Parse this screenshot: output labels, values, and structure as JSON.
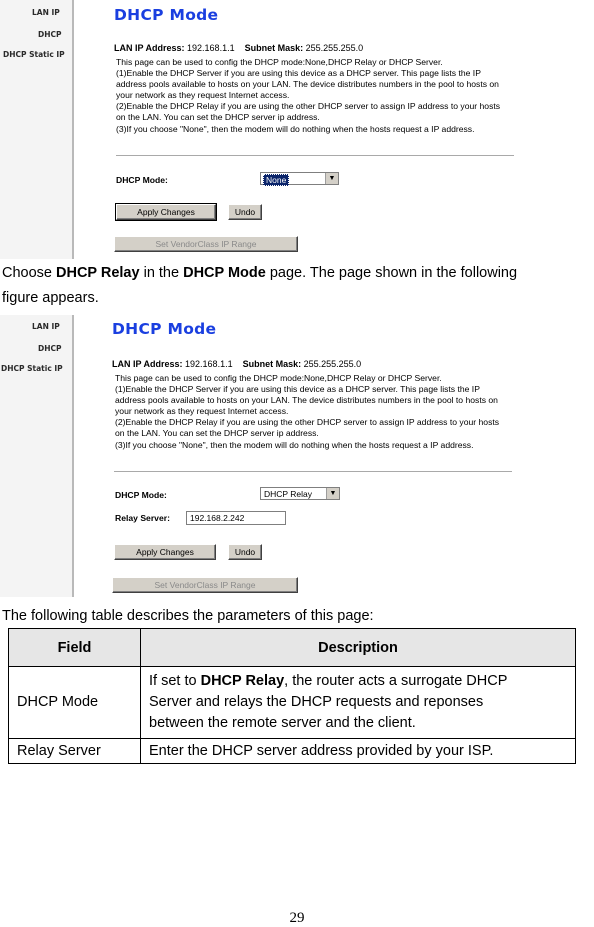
{
  "screenshot1": {
    "sidebar": [
      "LAN IP",
      "DHCP",
      "DHCP Static IP"
    ],
    "title": "DHCP Mode",
    "lan_ip_label": "LAN IP Address:",
    "lan_ip_value": "192.168.1.1",
    "subnet_label": "Subnet Mask:",
    "subnet_value": "255.255.255.0",
    "description": [
      "This page can be used to config the DHCP mode:None,DHCP Relay or DHCP Server.",
      "(1)Enable the DHCP Server if you are using this device as a DHCP server. This page lists the IP",
      "address pools available to hosts on your LAN. The device distributes numbers in the pool to hosts on",
      "your network as they request Internet access.",
      "(2)Enable the DHCP Relay if you are using the other DHCP server to assign IP address to your hosts",
      "on the LAN. You can set the DHCP server ip address.",
      "(3)If you choose \"None\", then the modem will do nothing when the hosts request a IP address."
    ],
    "dhcp_mode_label": "DHCP Mode:",
    "dhcp_mode_value": "None",
    "apply_label": "Apply Changes",
    "undo_label": "Undo",
    "vendor_label": "Set VendorClass IP Range"
  },
  "para1_parts": [
    "Choose ",
    "DHCP Relay",
    " in the ",
    "DHCP Mode",
    " page. The page shown in the following"
  ],
  "para1_line2": "figure appears.",
  "screenshot2": {
    "sidebar": [
      "LAN IP",
      "DHCP",
      "DHCP Static IP"
    ],
    "title": "DHCP Mode",
    "lan_ip_label": "LAN IP Address:",
    "lan_ip_value": "192.168.1.1",
    "subnet_label": "Subnet Mask:",
    "subnet_value": "255.255.255.0",
    "description": [
      "This page can be used to config the DHCP mode:None,DHCP Relay or DHCP Server.",
      "(1)Enable the DHCP Server if you are using this device as a DHCP server. This page lists the IP",
      "address pools available to hosts on your LAN. The device distributes numbers in the pool to hosts on",
      "your network as they request Internet access.",
      "(2)Enable the DHCP Relay if you are using the other DHCP server to assign IP address to your hosts",
      "on the LAN. You can set the DHCP server ip address.",
      "(3)If you choose \"None\", then the modem will do nothing when the hosts request a IP address."
    ],
    "dhcp_mode_label": "DHCP Mode:",
    "dhcp_mode_value": "DHCP Relay",
    "relay_label": "Relay Server:",
    "relay_value": "192.168.2.242",
    "apply_label": "Apply Changes",
    "undo_label": "Undo",
    "vendor_label": "Set VendorClass IP Range"
  },
  "para2": "The following table describes the parameters of this page:",
  "table": {
    "headers": [
      "Field",
      "Description"
    ],
    "rows": [
      {
        "field": "DHCP Mode",
        "desc_pre": "If set to ",
        "desc_bold": "DHCP Relay",
        "desc_post": ", the router acts a surrogate DHCP",
        "desc_line2": "Server and relays the DHCP requests and reponses",
        "desc_line3": "between the remote server and the client."
      },
      {
        "field": "Relay Server",
        "desc": "Enter the DHCP server address provided by your ISP."
      }
    ]
  },
  "page_number": "29"
}
